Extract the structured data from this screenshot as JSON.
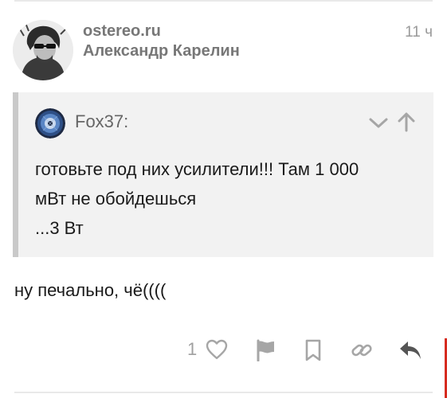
{
  "header": {
    "site": "ostereo.ru",
    "author": "Александр Карелин",
    "time": "11 ч"
  },
  "quote": {
    "author": "Fox37:",
    "lines": [
      "готовьте под них усилители!!! Там 1 000",
      "мВт не обойдешься",
      "...3 Вт"
    ]
  },
  "comment": {
    "text": "ну печально, чё(((("
  },
  "actions": {
    "like_count": "1",
    "icons": [
      "heart-icon",
      "flag-icon",
      "bookmark-icon",
      "link-icon",
      "reply-icon"
    ]
  },
  "colors": {
    "accent_red": "#d62b1f",
    "quote_bg": "#f2f2f2",
    "icon_gray": "#a6a6a6",
    "reply_dark": "#555555"
  }
}
